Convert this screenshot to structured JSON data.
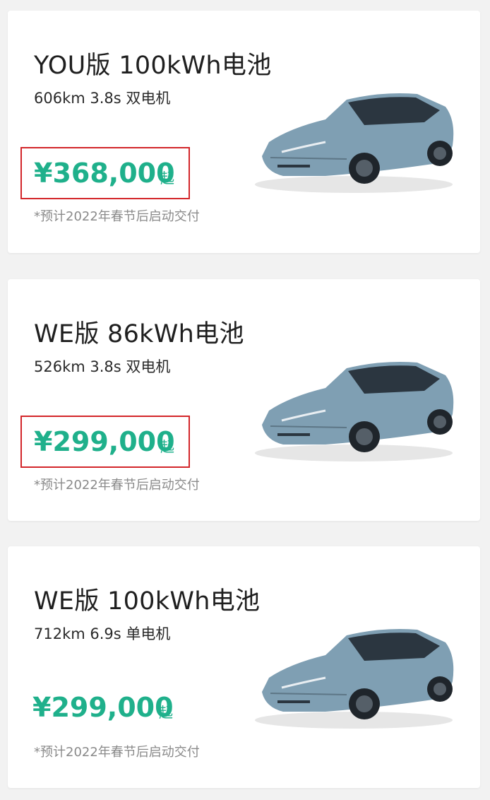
{
  "colors": {
    "price": "#1fb08b",
    "highlight_border": "#d3262a",
    "car_body": "#7f9fb3",
    "card_bg": "#ffffff",
    "page_bg": "#f2f2f2"
  },
  "cards": [
    {
      "title": "YOU版 100kWh电池",
      "specs": "606km 3.8s 双电机",
      "price": "¥368,000",
      "price_suffix": "起",
      "note": "*预计2022年春节后启动交付",
      "highlighted": true,
      "image": "car-image"
    },
    {
      "title": "WE版 86kWh电池",
      "specs": "526km 3.8s 双电机",
      "price": "¥299,000",
      "price_suffix": "起",
      "note": "*预计2022年春节后启动交付",
      "highlighted": true,
      "image": "car-image"
    },
    {
      "title": "WE版 100kWh电池",
      "specs": "712km 6.9s 单电机",
      "price": "¥299,000",
      "price_suffix": "起",
      "note": "*预计2022年春节后启动交付",
      "highlighted": false,
      "image": "car-image"
    }
  ]
}
